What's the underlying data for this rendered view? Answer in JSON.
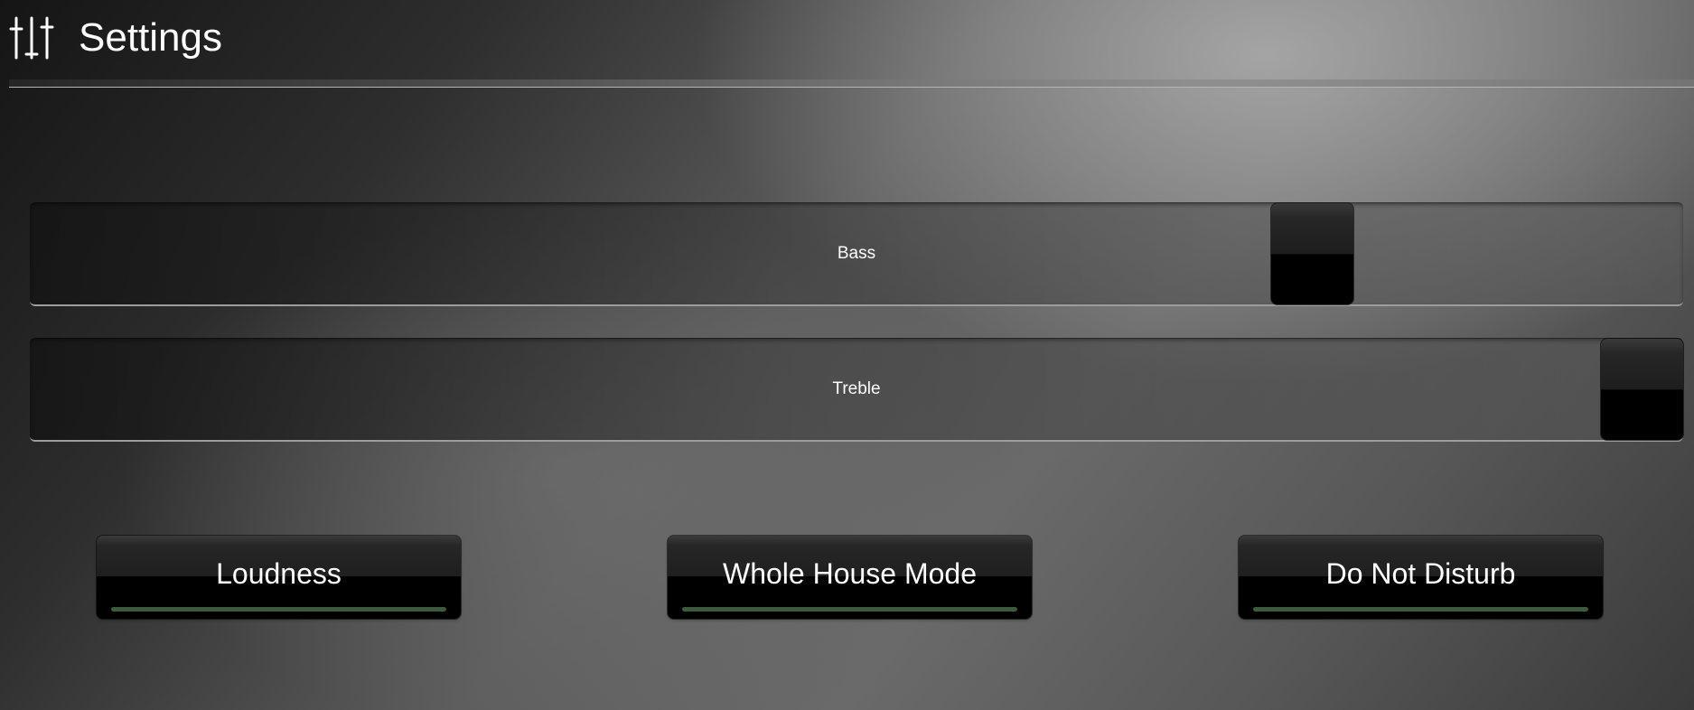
{
  "header": {
    "title": "Settings",
    "icon": "sliders-icon"
  },
  "sliders": [
    {
      "label": "Bass",
      "value_fraction": 0.79
    },
    {
      "label": "Treble",
      "value_fraction": 1.0
    }
  ],
  "buttons": [
    {
      "label": "Loudness",
      "active": false
    },
    {
      "label": "Whole House Mode",
      "active": false
    },
    {
      "label": "Do Not Disturb",
      "active": false
    }
  ],
  "colors": {
    "indicator_inactive": "#3d5a3d",
    "text": "#ffffff",
    "button_body": "#000000"
  }
}
